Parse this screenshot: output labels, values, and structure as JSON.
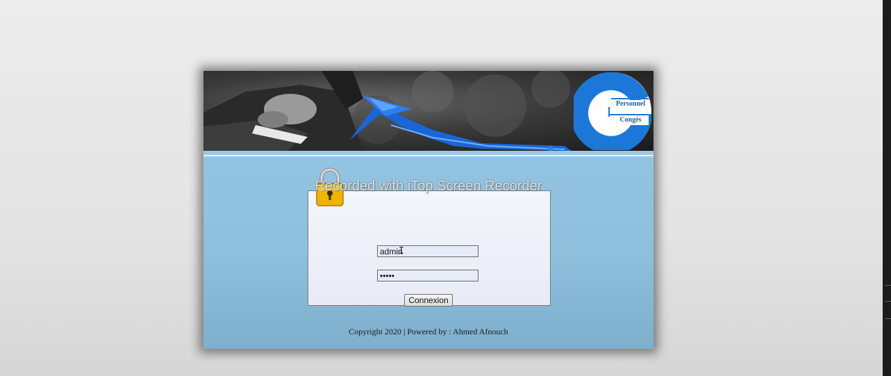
{
  "banner": {
    "logo_line1": "Personnel",
    "logo_line2": "Congés"
  },
  "overlay": {
    "watermark": "Recorded with iTop Screen Recorder"
  },
  "login": {
    "username_value": "admin",
    "password_value": "admin",
    "submit_label": "Connexion"
  },
  "footer": {
    "copyright": "Copyright 2020 | Powered by : Ahmed Afnouch"
  },
  "icons": {
    "lock": "padlock-icon",
    "logo": "personnel-conges-logo"
  },
  "colors": {
    "content_bg": "#8fbfde",
    "logo_blue": "#1b78d8",
    "lock_gold": "#f0b400"
  }
}
